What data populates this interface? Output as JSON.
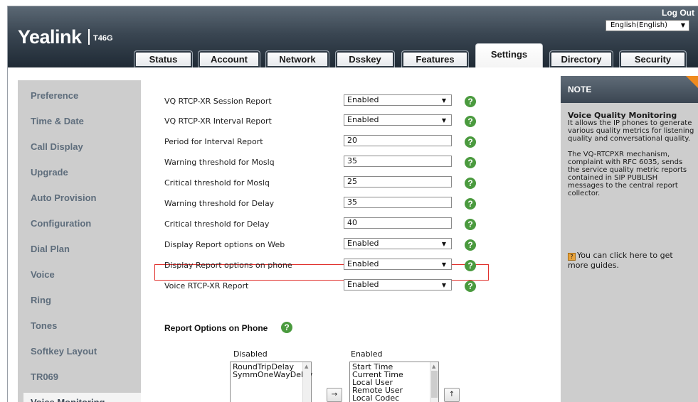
{
  "header": {
    "logo": "Yealink",
    "model": "T46G",
    "logout": "Log Out",
    "language": "English(English)",
    "tabs": [
      "Status",
      "Account",
      "Network",
      "Dsskey",
      "Features",
      "Settings",
      "Directory",
      "Security"
    ],
    "active_tab": "Settings"
  },
  "sidebar": {
    "items": [
      "Preference",
      "Time & Date",
      "Call Display",
      "Upgrade",
      "Auto Provision",
      "Configuration",
      "Dial Plan",
      "Voice",
      "Ring",
      "Tones",
      "Softkey Layout",
      "TR069",
      "Voice Monitoring"
    ],
    "active_item": "Voice Monitoring"
  },
  "form": {
    "rows": [
      {
        "label": "VQ RTCP-XR Session Report",
        "value": "Enabled",
        "type": "select"
      },
      {
        "label": "VQ RTCP-XR Interval Report",
        "value": "Enabled",
        "type": "select"
      },
      {
        "label": "Period for Interval Report",
        "value": "20",
        "type": "text"
      },
      {
        "label": "Warning threshold for Moslq",
        "value": "35",
        "type": "text"
      },
      {
        "label": "Critical threshold for Moslq",
        "value": "25",
        "type": "text"
      },
      {
        "label": "Warning threshold for Delay",
        "value": "35",
        "type": "text"
      },
      {
        "label": "Critical threshold for Delay",
        "value": "40",
        "type": "text"
      },
      {
        "label": "Display Report options on Web",
        "value": "Enabled",
        "type": "select"
      },
      {
        "label": "Display Report options on phone",
        "value": "Enabled",
        "type": "select"
      },
      {
        "label": "Voice RTCP-XR Report",
        "value": "Enabled",
        "type": "select"
      }
    ],
    "help_glyph": "?",
    "report_options_title": "Report Options on Phone",
    "disabled_title": "Disabled",
    "enabled_title": "Enabled",
    "disabled_items": [
      "RoundTripDelay",
      "SymmOneWayDelay"
    ],
    "enabled_items": [
      "Start Time",
      "Current Time",
      "Local User",
      "Remote User",
      "Local Codec"
    ],
    "move_right_glyph": "→",
    "move_up_glyph": "↑"
  },
  "note": {
    "title": "NOTE",
    "heading": "Voice Quality Monitoring",
    "para1": "It allows the IP phones to generate various quality metrics for listening quality and conversational quality.",
    "para2": "The VQ-RTCPXR mechanism, complaint with RFC 6035, sends the service quality metric reports contained in SIP PUBLISH messages to the central report collector.",
    "guide": "You can click here to get more guides."
  },
  "colors": {
    "accent_orange": "#ef8a1e",
    "help_green": "#4a9a3e",
    "highlight_red": "#e0302c"
  }
}
